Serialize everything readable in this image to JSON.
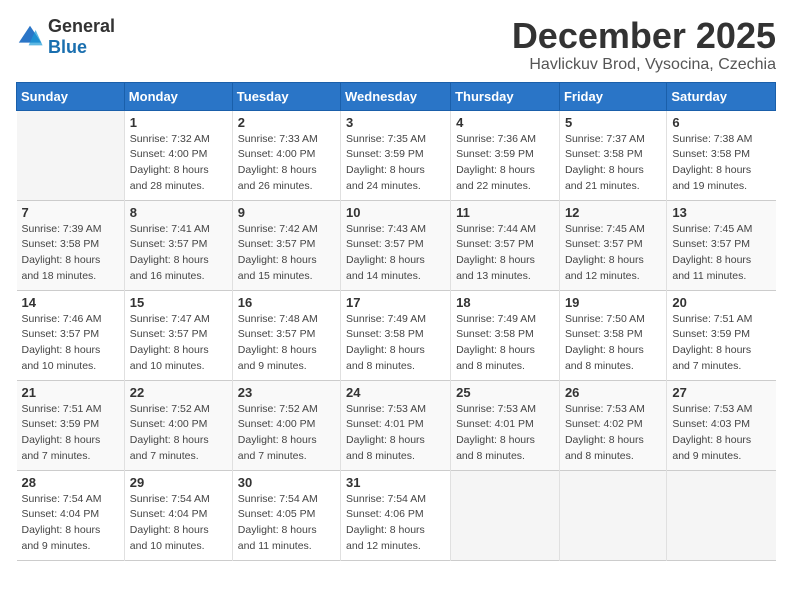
{
  "logo": {
    "text_general": "General",
    "text_blue": "Blue"
  },
  "title": "December 2025",
  "subtitle": "Havlickuv Brod, Vysocina, Czechia",
  "days_header": [
    "Sunday",
    "Monday",
    "Tuesday",
    "Wednesday",
    "Thursday",
    "Friday",
    "Saturday"
  ],
  "weeks": [
    [
      {
        "day": "",
        "sunrise": "",
        "sunset": "",
        "daylight": ""
      },
      {
        "day": "1",
        "sunrise": "Sunrise: 7:32 AM",
        "sunset": "Sunset: 4:00 PM",
        "daylight": "Daylight: 8 hours and 28 minutes."
      },
      {
        "day": "2",
        "sunrise": "Sunrise: 7:33 AM",
        "sunset": "Sunset: 4:00 PM",
        "daylight": "Daylight: 8 hours and 26 minutes."
      },
      {
        "day": "3",
        "sunrise": "Sunrise: 7:35 AM",
        "sunset": "Sunset: 3:59 PM",
        "daylight": "Daylight: 8 hours and 24 minutes."
      },
      {
        "day": "4",
        "sunrise": "Sunrise: 7:36 AM",
        "sunset": "Sunset: 3:59 PM",
        "daylight": "Daylight: 8 hours and 22 minutes."
      },
      {
        "day": "5",
        "sunrise": "Sunrise: 7:37 AM",
        "sunset": "Sunset: 3:58 PM",
        "daylight": "Daylight: 8 hours and 21 minutes."
      },
      {
        "day": "6",
        "sunrise": "Sunrise: 7:38 AM",
        "sunset": "Sunset: 3:58 PM",
        "daylight": "Daylight: 8 hours and 19 minutes."
      }
    ],
    [
      {
        "day": "7",
        "sunrise": "Sunrise: 7:39 AM",
        "sunset": "Sunset: 3:58 PM",
        "daylight": "Daylight: 8 hours and 18 minutes."
      },
      {
        "day": "8",
        "sunrise": "Sunrise: 7:41 AM",
        "sunset": "Sunset: 3:57 PM",
        "daylight": "Daylight: 8 hours and 16 minutes."
      },
      {
        "day": "9",
        "sunrise": "Sunrise: 7:42 AM",
        "sunset": "Sunset: 3:57 PM",
        "daylight": "Daylight: 8 hours and 15 minutes."
      },
      {
        "day": "10",
        "sunrise": "Sunrise: 7:43 AM",
        "sunset": "Sunset: 3:57 PM",
        "daylight": "Daylight: 8 hours and 14 minutes."
      },
      {
        "day": "11",
        "sunrise": "Sunrise: 7:44 AM",
        "sunset": "Sunset: 3:57 PM",
        "daylight": "Daylight: 8 hours and 13 minutes."
      },
      {
        "day": "12",
        "sunrise": "Sunrise: 7:45 AM",
        "sunset": "Sunset: 3:57 PM",
        "daylight": "Daylight: 8 hours and 12 minutes."
      },
      {
        "day": "13",
        "sunrise": "Sunrise: 7:45 AM",
        "sunset": "Sunset: 3:57 PM",
        "daylight": "Daylight: 8 hours and 11 minutes."
      }
    ],
    [
      {
        "day": "14",
        "sunrise": "Sunrise: 7:46 AM",
        "sunset": "Sunset: 3:57 PM",
        "daylight": "Daylight: 8 hours and 10 minutes."
      },
      {
        "day": "15",
        "sunrise": "Sunrise: 7:47 AM",
        "sunset": "Sunset: 3:57 PM",
        "daylight": "Daylight: 8 hours and 10 minutes."
      },
      {
        "day": "16",
        "sunrise": "Sunrise: 7:48 AM",
        "sunset": "Sunset: 3:57 PM",
        "daylight": "Daylight: 8 hours and 9 minutes."
      },
      {
        "day": "17",
        "sunrise": "Sunrise: 7:49 AM",
        "sunset": "Sunset: 3:58 PM",
        "daylight": "Daylight: 8 hours and 8 minutes."
      },
      {
        "day": "18",
        "sunrise": "Sunrise: 7:49 AM",
        "sunset": "Sunset: 3:58 PM",
        "daylight": "Daylight: 8 hours and 8 minutes."
      },
      {
        "day": "19",
        "sunrise": "Sunrise: 7:50 AM",
        "sunset": "Sunset: 3:58 PM",
        "daylight": "Daylight: 8 hours and 8 minutes."
      },
      {
        "day": "20",
        "sunrise": "Sunrise: 7:51 AM",
        "sunset": "Sunset: 3:59 PM",
        "daylight": "Daylight: 8 hours and 7 minutes."
      }
    ],
    [
      {
        "day": "21",
        "sunrise": "Sunrise: 7:51 AM",
        "sunset": "Sunset: 3:59 PM",
        "daylight": "Daylight: 8 hours and 7 minutes."
      },
      {
        "day": "22",
        "sunrise": "Sunrise: 7:52 AM",
        "sunset": "Sunset: 4:00 PM",
        "daylight": "Daylight: 8 hours and 7 minutes."
      },
      {
        "day": "23",
        "sunrise": "Sunrise: 7:52 AM",
        "sunset": "Sunset: 4:00 PM",
        "daylight": "Daylight: 8 hours and 7 minutes."
      },
      {
        "day": "24",
        "sunrise": "Sunrise: 7:53 AM",
        "sunset": "Sunset: 4:01 PM",
        "daylight": "Daylight: 8 hours and 8 minutes."
      },
      {
        "day": "25",
        "sunrise": "Sunrise: 7:53 AM",
        "sunset": "Sunset: 4:01 PM",
        "daylight": "Daylight: 8 hours and 8 minutes."
      },
      {
        "day": "26",
        "sunrise": "Sunrise: 7:53 AM",
        "sunset": "Sunset: 4:02 PM",
        "daylight": "Daylight: 8 hours and 8 minutes."
      },
      {
        "day": "27",
        "sunrise": "Sunrise: 7:53 AM",
        "sunset": "Sunset: 4:03 PM",
        "daylight": "Daylight: 8 hours and 9 minutes."
      }
    ],
    [
      {
        "day": "28",
        "sunrise": "Sunrise: 7:54 AM",
        "sunset": "Sunset: 4:04 PM",
        "daylight": "Daylight: 8 hours and 9 minutes."
      },
      {
        "day": "29",
        "sunrise": "Sunrise: 7:54 AM",
        "sunset": "Sunset: 4:04 PM",
        "daylight": "Daylight: 8 hours and 10 minutes."
      },
      {
        "day": "30",
        "sunrise": "Sunrise: 7:54 AM",
        "sunset": "Sunset: 4:05 PM",
        "daylight": "Daylight: 8 hours and 11 minutes."
      },
      {
        "day": "31",
        "sunrise": "Sunrise: 7:54 AM",
        "sunset": "Sunset: 4:06 PM",
        "daylight": "Daylight: 8 hours and 12 minutes."
      },
      {
        "day": "",
        "sunrise": "",
        "sunset": "",
        "daylight": ""
      },
      {
        "day": "",
        "sunrise": "",
        "sunset": "",
        "daylight": ""
      },
      {
        "day": "",
        "sunrise": "",
        "sunset": "",
        "daylight": ""
      }
    ]
  ]
}
